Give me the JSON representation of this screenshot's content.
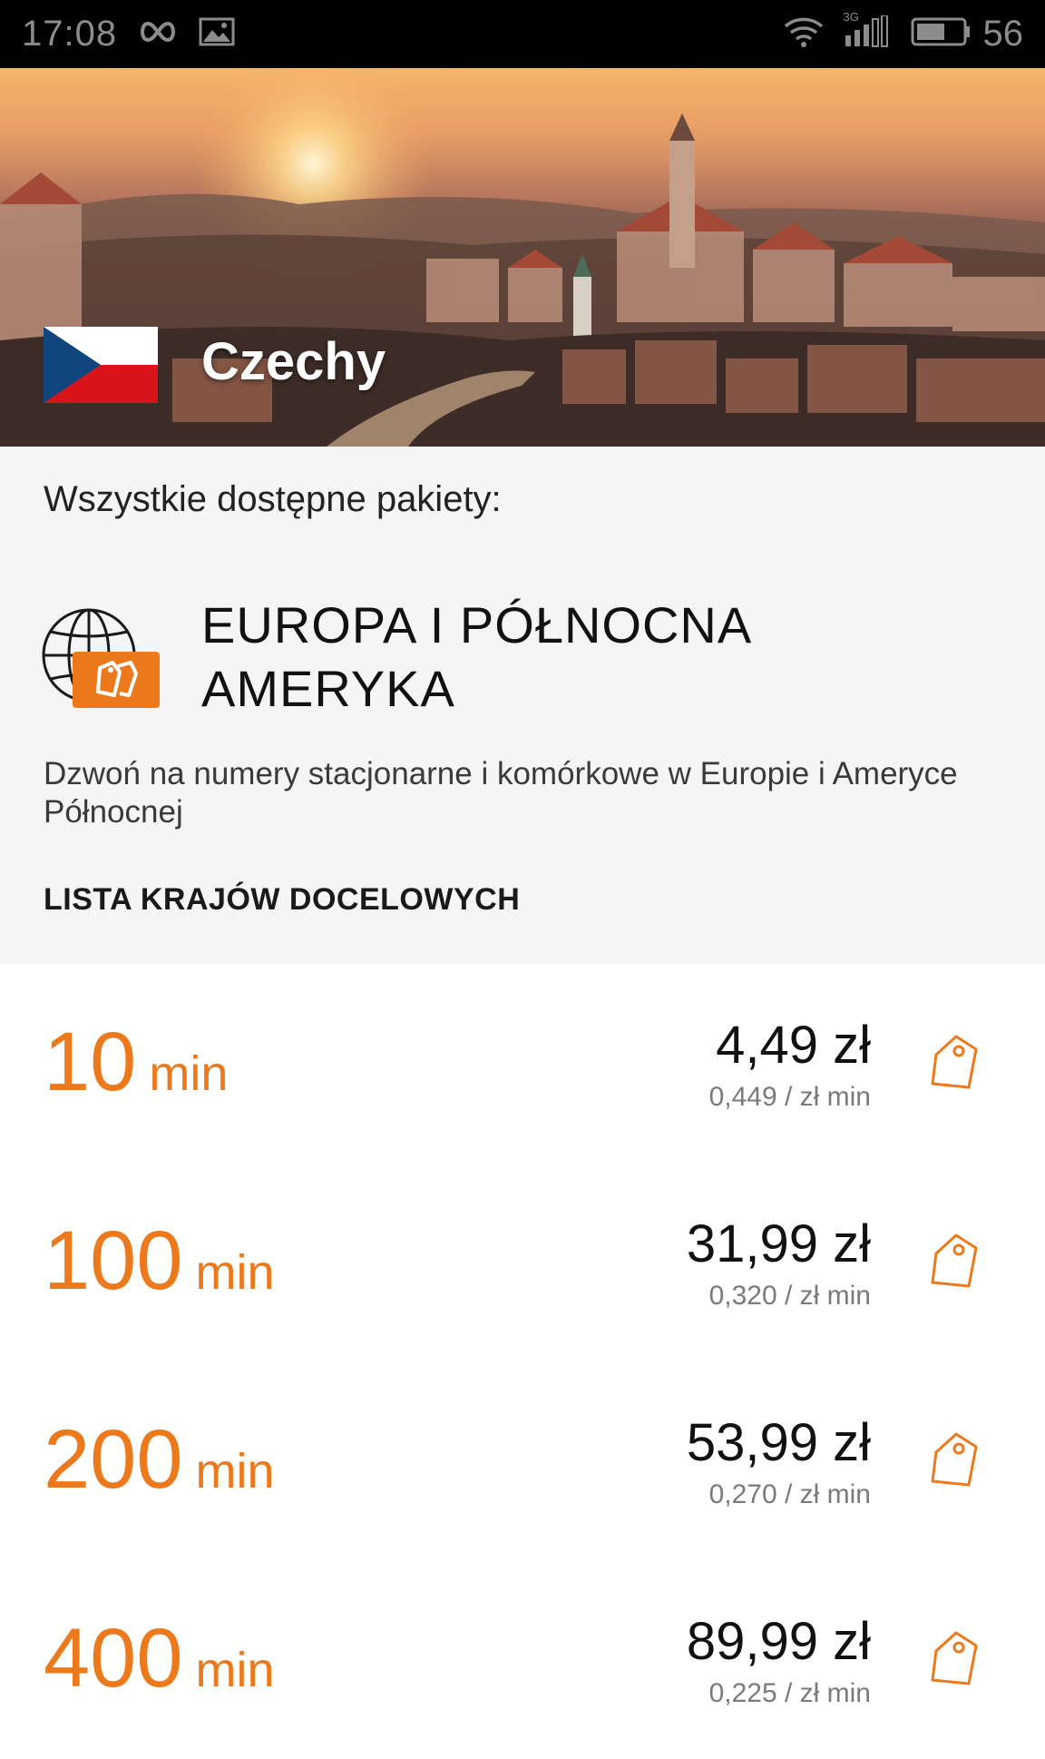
{
  "status_bar": {
    "time": "17:08",
    "network": "3G",
    "battery": "56",
    "icons": [
      "infinity-icon",
      "image-icon",
      "wifi-icon",
      "signal-icon",
      "battery-icon"
    ]
  },
  "hero": {
    "country": "Czechy",
    "flag": "czech-flag"
  },
  "info": {
    "heading": "Wszystkie dostępne pakiety:",
    "package_title_line1": "EUROPA I PÓŁNOCNA",
    "package_title_line2": "AMERYKA",
    "description": "Dzwoń na numery stacjonarne i komórkowe w Europie i Ameryce Północnej",
    "country_list_label": "LISTA KRAJÓW DOCELOWYCH"
  },
  "offers": [
    {
      "minutes": "10",
      "unit": "min",
      "price": "4,49 zł",
      "rate": "0,449 / zł min"
    },
    {
      "minutes": "100",
      "unit": "min",
      "price": "31,99 zł",
      "rate": "0,320 / zł min"
    },
    {
      "minutes": "200",
      "unit": "min",
      "price": "53,99 zł",
      "rate": "0,270 / zł min"
    },
    {
      "minutes": "400",
      "unit": "min",
      "price": "89,99 zł",
      "rate": "0,225 / zł min"
    }
  ],
  "colors": {
    "accent": "#ec7a1d",
    "status_bar": "#000000",
    "info_background": "#f5f5f5"
  }
}
